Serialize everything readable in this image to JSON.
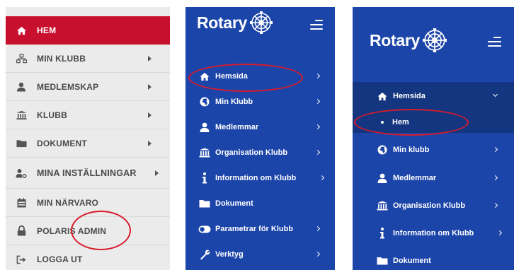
{
  "panel_old": {
    "items": [
      {
        "label": "HEM",
        "icon": "home-icon",
        "active": true,
        "arrow": false
      },
      {
        "label": "MIN KLUBB",
        "icon": "sitemap-icon",
        "active": false,
        "arrow": true
      },
      {
        "label": "MEDLEMSKAP",
        "icon": "user-icon",
        "active": false,
        "arrow": true
      },
      {
        "label": "KLUBB",
        "icon": "bank-icon",
        "active": false,
        "arrow": true
      },
      {
        "label": "DOKUMENT",
        "icon": "folder-icon",
        "active": false,
        "arrow": true
      },
      {
        "label": "MINA INSTÄLLNINGAR",
        "icon": "user-cog-icon",
        "active": false,
        "arrow": true
      },
      {
        "label": "MIN NÄRVARO",
        "icon": "calendar-icon",
        "active": false,
        "arrow": false
      },
      {
        "label": "POLARIS ADMIN",
        "icon": "lock-icon",
        "active": false,
        "arrow": false
      },
      {
        "label": "LOGGA UT",
        "icon": "sign-out-icon",
        "active": false,
        "arrow": false
      }
    ],
    "active_color": "#c8102e"
  },
  "panel_mid": {
    "brand": "Rotary",
    "items": [
      {
        "label": "Hemsida",
        "icon": "home-icon"
      },
      {
        "label": "Min Klubb",
        "icon": "globe-icon"
      },
      {
        "label": "Medlemmar",
        "icon": "user-icon"
      },
      {
        "label": "Organisation Klubb",
        "icon": "bank-icon"
      },
      {
        "label": "Information om Klubb",
        "icon": "info-icon"
      },
      {
        "label": "Dokument",
        "icon": "folder-icon"
      },
      {
        "label": "Parametrar för Klubb",
        "icon": "toggle-icon"
      },
      {
        "label": "Verktyg",
        "icon": "wrench-icon"
      }
    ]
  },
  "panel_new": {
    "brand": "Rotary",
    "items": [
      {
        "label": "Hemsida",
        "icon": "home-icon"
      },
      {
        "label": "Hem",
        "icon": "bullet-icon"
      },
      {
        "label": "Min klubb",
        "icon": "globe-icon"
      },
      {
        "label": "Medlemmar",
        "icon": "user-icon"
      },
      {
        "label": "Organisation Klubb",
        "icon": "bank-icon"
      },
      {
        "label": "Information om Klubb",
        "icon": "info-icon"
      },
      {
        "label": "Dokument",
        "icon": "folder-icon"
      }
    ]
  },
  "colors": {
    "rotary_blue": "#1c45a9",
    "rotary_blue_dark": "#14357f",
    "highlight_red": "#d81b2b"
  }
}
